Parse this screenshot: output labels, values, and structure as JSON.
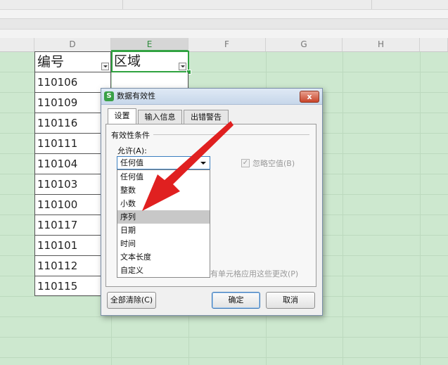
{
  "sheet": {
    "columns": [
      "D",
      "E",
      "F",
      "G",
      "H"
    ],
    "selected_column": "E",
    "header_cells": {
      "d": "编号",
      "e": "区域"
    },
    "ids": [
      "110106",
      "110109",
      "110116",
      "110111",
      "110104",
      "110103",
      "110100",
      "110117",
      "110101",
      "110112",
      "110115"
    ]
  },
  "dialog": {
    "title": "数据有效性",
    "icon_letter": "S",
    "close_label": "x",
    "tabs": [
      "设置",
      "输入信息",
      "出错警告"
    ],
    "group_label": "有效性条件",
    "allow_label": "允许(A):",
    "allow_selected": "任何值",
    "allow_options": [
      "任何值",
      "整数",
      "小数",
      "序列",
      "日期",
      "时间",
      "文本长度",
      "自定义"
    ],
    "highlighted_option": "序列",
    "ignore_blank_label": "忽略空值(B)",
    "ignore_blank_check": "✓",
    "apply_label": "所有单元格应用这些更改(P)",
    "clear_all_label": "全部清除(C)",
    "ok_label": "确定",
    "cancel_label": "取消"
  },
  "colors": {
    "sheet_bg": "#cde8cf",
    "selection_green": "#2fa23f",
    "arrow_red": "#e02020"
  }
}
